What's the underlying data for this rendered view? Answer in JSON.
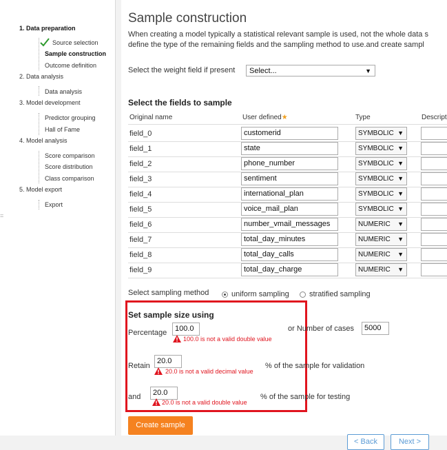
{
  "sidebar": {
    "steps": [
      {
        "label": "1. Data preparation"
      },
      {
        "label": "Source selection"
      },
      {
        "label": "Sample construction"
      },
      {
        "label": "Outcome definition"
      },
      {
        "label": "2. Data analysis"
      },
      {
        "label": "Data analysis"
      },
      {
        "label": "3. Model development"
      },
      {
        "label": "Predictor grouping"
      },
      {
        "label": "Hall of Fame"
      },
      {
        "label": "4. Model analysis"
      },
      {
        "label": "Score comparison"
      },
      {
        "label": "Score distribution"
      },
      {
        "label": "Class comparison"
      },
      {
        "label": "5. Model export"
      },
      {
        "label": "Export"
      }
    ]
  },
  "main": {
    "title": "Sample construction",
    "description": [
      "When creating a model typically a statistical relevant sample is used, not the whole data s",
      "define the type of the remaining fields and the sampling method to use.and create sampl"
    ],
    "weight_label": "Select the weight field if present",
    "weight_value": "Select...",
    "fields_heading": "Select the fields to sample",
    "columns": {
      "original": "Original name",
      "user": "User defined",
      "type": "Type",
      "desc": "Descript"
    },
    "rows": [
      {
        "original": "field_0",
        "user": "customerid",
        "type": "SYMBOLIC"
      },
      {
        "original": "field_1",
        "user": "state",
        "type": "SYMBOLIC"
      },
      {
        "original": "field_2",
        "user": "phone_number",
        "type": "SYMBOLIC"
      },
      {
        "original": "field_3",
        "user": "sentiment",
        "type": "SYMBOLIC"
      },
      {
        "original": "field_4",
        "user": "international_plan",
        "type": "SYMBOLIC"
      },
      {
        "original": "field_5",
        "user": "voice_mail_plan",
        "type": "SYMBOLIC"
      },
      {
        "original": "field_6",
        "user": "number_vmail_messages",
        "type": "NUMERIC"
      },
      {
        "original": "field_7",
        "user": "total_day_minutes",
        "type": "NUMERIC"
      },
      {
        "original": "field_8",
        "user": "total_day_calls",
        "type": "NUMERIC"
      },
      {
        "original": "field_9",
        "user": "total_day_charge",
        "type": "NUMERIC"
      }
    ],
    "sampling_label": "Select sampling method",
    "sampling_uniform": "uniform sampling",
    "sampling_stratified": "stratified sampling",
    "size_heading": "Set sample size using",
    "percentage_label": "Percentage",
    "percentage_value": "100.0",
    "percentage_error": "100.0 is not a valid double value",
    "cases_label": "or Number of cases",
    "cases_value": "5000",
    "retain_label": "Retain",
    "retain_value": "20.0",
    "retain_error": "20.0 is not a valid decimal value",
    "validation_label": "% of the sample for validation",
    "and_label": "and",
    "testing_value": "20.0",
    "testing_error": "20.0 is not a valid double value",
    "testing_label": "% of the sample for testing",
    "create_button": "Create sample"
  },
  "footer": {
    "back": "< Back",
    "next": "Next >"
  },
  "colors": {
    "accent": "#f58220",
    "error": "#e0141e",
    "nav": "#5b9bd5",
    "check": "#2e9a2e"
  }
}
